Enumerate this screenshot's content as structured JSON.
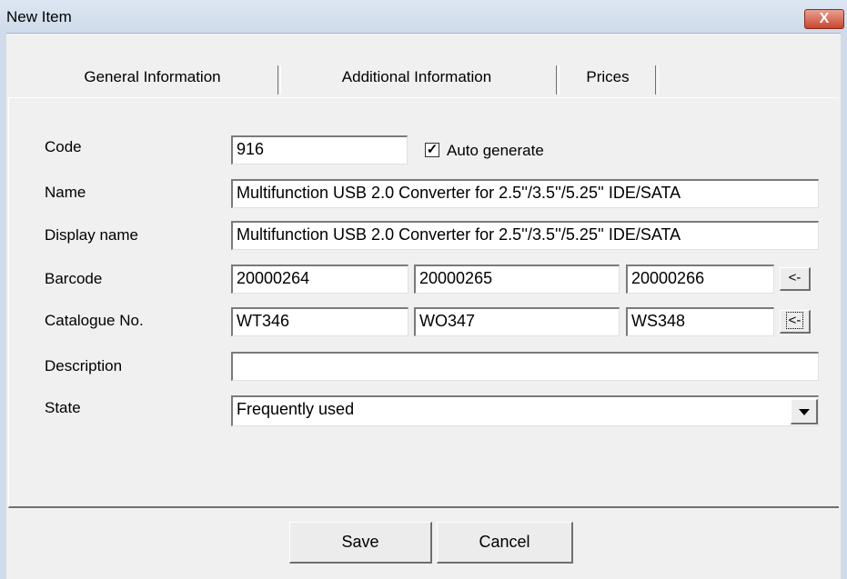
{
  "window": {
    "title": "New Item",
    "close_glyph": "X"
  },
  "tabs": [
    {
      "label": "General Information"
    },
    {
      "label": "Additional Information"
    },
    {
      "label": "Prices"
    }
  ],
  "form": {
    "code": {
      "label": "Code",
      "value": "916",
      "auto_generate_label": "Auto generate",
      "auto_generate_checked": true,
      "check_glyph": "✓"
    },
    "name": {
      "label": "Name",
      "value": "Multifunction USB 2.0 Converter for 2.5''/3.5''/5.25'' IDE/SATA"
    },
    "display_name": {
      "label": "Display name",
      "value": "Multifunction USB 2.0 Converter for 2.5''/3.5''/5.25'' IDE/SATA"
    },
    "barcode": {
      "label": "Barcode",
      "values": [
        "20000264",
        "20000265",
        "20000266"
      ],
      "button_label": "<-"
    },
    "catalogue": {
      "label": "Catalogue No.",
      "values": [
        "WT346",
        "WO347",
        "WS348"
      ],
      "button_label": "<-"
    },
    "description": {
      "label": "Description",
      "value": ""
    },
    "state": {
      "label": "State",
      "value": "Frequently used"
    }
  },
  "buttons": {
    "save": "Save",
    "cancel": "Cancel"
  }
}
